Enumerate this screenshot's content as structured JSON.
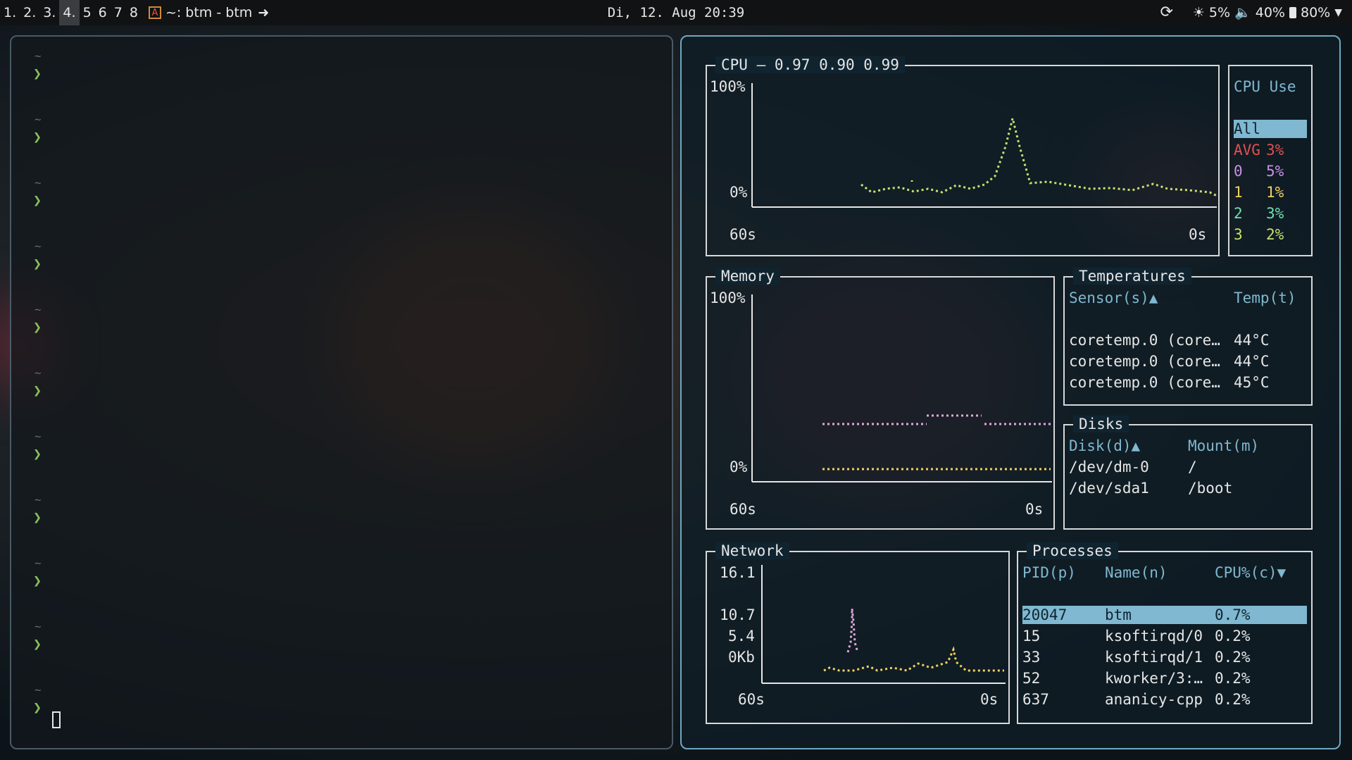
{
  "topbar": {
    "workspaces": [
      "1.",
      "2.",
      "3.",
      "4.",
      "5",
      "6",
      "7",
      "8"
    ],
    "active_workspace": "4.",
    "window_title": "~: btm - btm",
    "datetime": "Di, 12. Aug  20:39",
    "brightness": "5%",
    "volume": "40%",
    "battery": "80%"
  },
  "terminal": {
    "tilde": "~",
    "prompt_symbol": "❯"
  },
  "btm": {
    "cpu": {
      "title": "CPU — 0.97 0.90 0.99",
      "y_max": "100%",
      "y_min": "0%",
      "x_start": "60s",
      "x_end": "0s",
      "legend_title": "CPU Use",
      "legend_all": "All",
      "legend": [
        {
          "label": "AVG",
          "value": "3%",
          "color": "#e05050"
        },
        {
          "label": "0",
          "value": "5%",
          "color": "#c890e8"
        },
        {
          "label": "1",
          "value": "1%",
          "color": "#f0d060"
        },
        {
          "label": "2",
          "value": "3%",
          "color": "#70e0b0"
        },
        {
          "label": "3",
          "value": "2%",
          "color": "#c8e070"
        }
      ]
    },
    "memory": {
      "title": "Memory",
      "y_max": "100%",
      "y_min": "0%",
      "x_start": "60s",
      "x_end": "0s"
    },
    "temperatures": {
      "title": "Temperatures",
      "col_sensor": "Sensor(s)▲",
      "col_temp": "Temp(t)",
      "rows": [
        {
          "sensor": "coretemp.0 (core…",
          "temp": "44°C"
        },
        {
          "sensor": "coretemp.0 (core…",
          "temp": "44°C"
        },
        {
          "sensor": "coretemp.0 (core…",
          "temp": "45°C"
        }
      ]
    },
    "disks": {
      "title": "Disks",
      "col_disk": "Disk(d)▲",
      "col_mount": "Mount(m)",
      "rows": [
        {
          "disk": "/dev/dm-0",
          "mount": "/"
        },
        {
          "disk": "/dev/sda1",
          "mount": "/boot"
        }
      ]
    },
    "network": {
      "title": "Network",
      "y_labels": [
        "16.1",
        "10.7",
        "5.4",
        "0Kb"
      ],
      "x_start": "60s",
      "x_end": "0s"
    },
    "processes": {
      "title": "Processes",
      "col_pid": "PID(p)",
      "col_name": "Name(n)",
      "col_cpu": "CPU%(c)▼",
      "rows": [
        {
          "pid": "20047",
          "name": "btm",
          "cpu": "0.7%"
        },
        {
          "pid": "15",
          "name": "ksoftirqd/0",
          "cpu": "0.2%"
        },
        {
          "pid": "33",
          "name": "ksoftirqd/1",
          "cpu": "0.2%"
        },
        {
          "pid": "52",
          "name": "kworker/3:…",
          "cpu": "0.2%"
        },
        {
          "pid": "637",
          "name": "ananicy-cpp",
          "cpu": "0.2%"
        }
      ]
    }
  }
}
